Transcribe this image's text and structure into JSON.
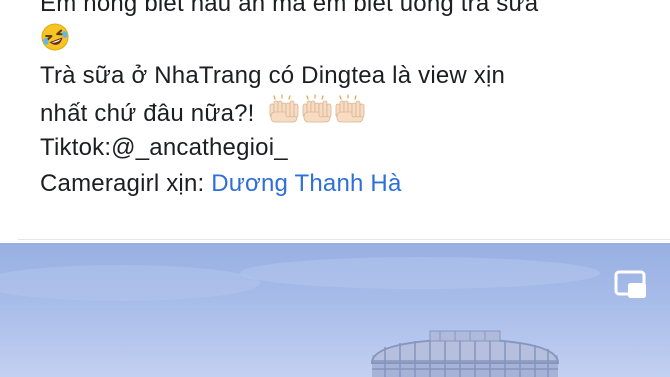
{
  "post": {
    "line_clipped": "Em hổng biết nấu ăn mà em biết uống trà sữa",
    "emoji_laugh": "rolling-on-floor-laughing-emoji",
    "line_1": "Trà sữa ở NhaTrang có Dingtea là view xịn",
    "line_2": "nhất chứ đâu nữa?!",
    "raising_hands": "raising-hands-emoji",
    "tiktok": "Tiktok:@_ancathegioi_",
    "camera_prefix": "Cameragirl xịn: ",
    "camera_mention": "Dương Thanh Hà"
  },
  "media": {
    "pip_icon": "picture-in-picture-icon",
    "sky_color": "#a6bbe8",
    "mention_color": "#2e6fd8"
  }
}
